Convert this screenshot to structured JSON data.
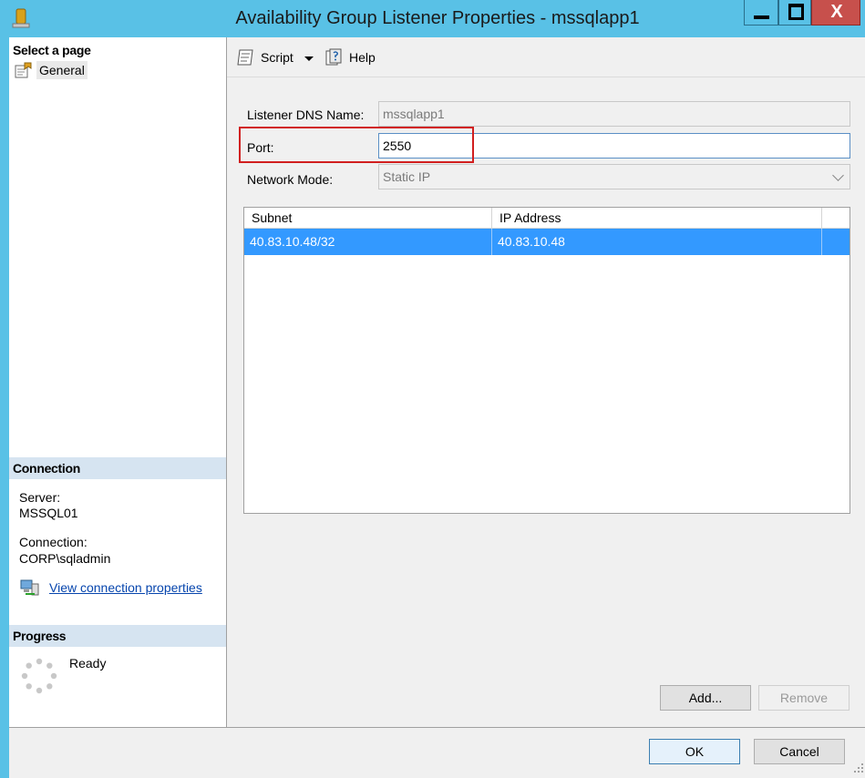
{
  "window": {
    "title": "Availability Group Listener Properties - mssqlapp1",
    "close_glyph": "X"
  },
  "left_pane": {
    "select_page_header": "Select a page",
    "pages": [
      {
        "label": "General",
        "icon": "properties-page-icon"
      }
    ],
    "connection_header": "Connection",
    "server_label": "Server:",
    "server_value": "MSSQL01",
    "connection_label": "Connection:",
    "connection_value": "CORP\\sqladmin",
    "view_connection_link": "View connection properties",
    "progress_header": "Progress",
    "progress_status": "Ready"
  },
  "toolbar": {
    "script_label": "Script",
    "help_label": "Help"
  },
  "form": {
    "dns_label": "Listener DNS Name:",
    "dns_value": "mssqlapp1",
    "port_label": "Port:",
    "port_value": "2550",
    "mode_label": "Network Mode:",
    "mode_value": "Static IP"
  },
  "grid": {
    "columns": [
      "Subnet",
      "IP Address"
    ],
    "rows": [
      {
        "subnet": "40.83.10.48/32",
        "ip": "40.83.10.48"
      }
    ]
  },
  "buttons": {
    "add": "Add...",
    "remove": "Remove",
    "ok": "OK",
    "cancel": "Cancel"
  },
  "colors": {
    "titlebar": "#59c1e6",
    "selection": "#3399ff",
    "highlight_box": "#d11f1f",
    "close_button": "#c7504c"
  }
}
